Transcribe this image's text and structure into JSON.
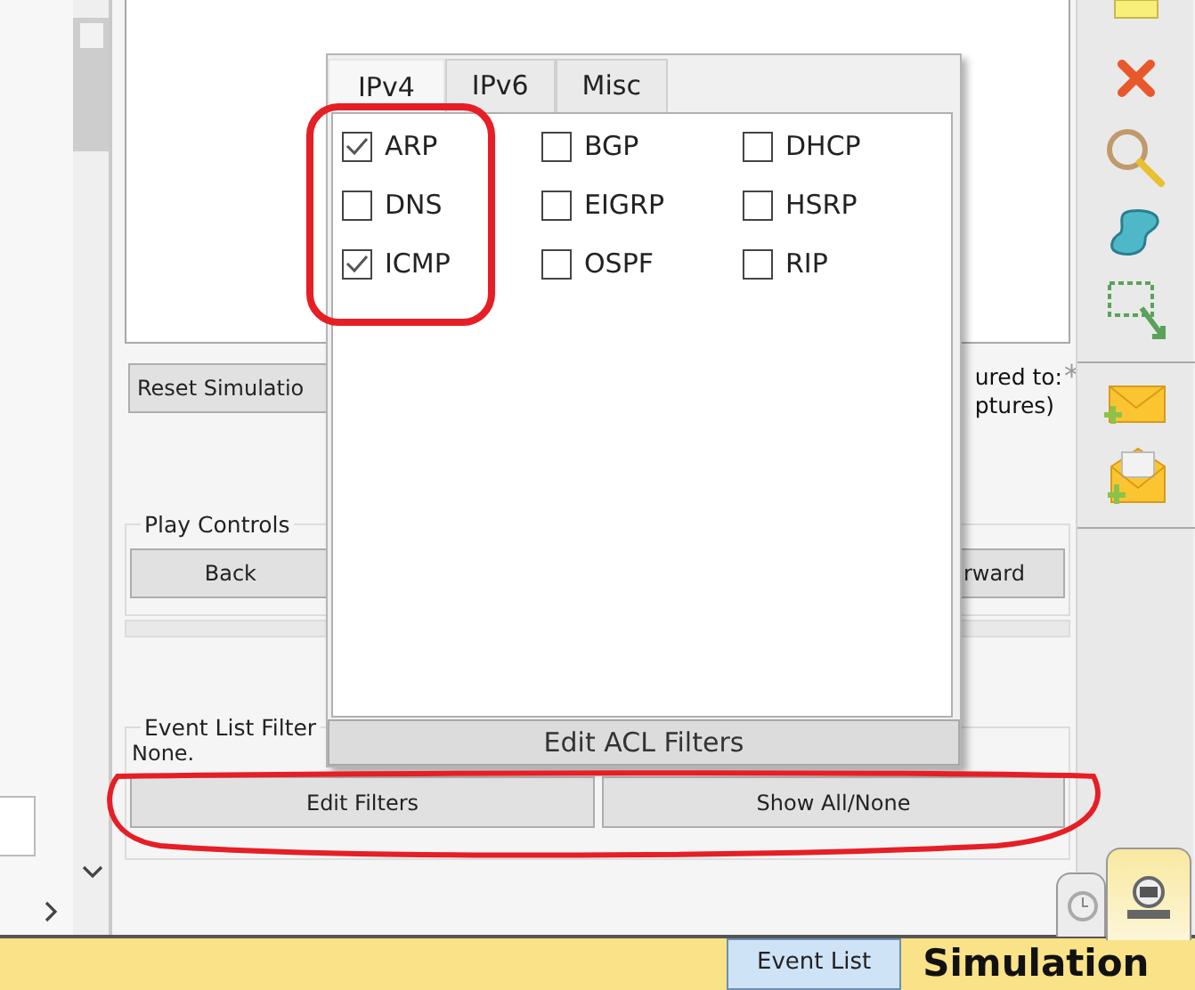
{
  "left_panel": {
    "reset_button": "Reset Simulatio",
    "capture_note": [
      "ured to:",
      "ptures)"
    ],
    "asterisk": "*",
    "play_controls": {
      "legend": "Play Controls",
      "back_button": "Back",
      "forward_button": "rward"
    },
    "event_list_filter": {
      "legend": "Event List Filter",
      "filter_text": "None.",
      "buttons": [
        "Edit Filters",
        "Show All/None"
      ]
    }
  },
  "filter_popup": {
    "tabs": [
      {
        "label": "IPv4",
        "selected": true
      },
      {
        "label": "IPv6",
        "selected": false
      },
      {
        "label": "Misc",
        "selected": false
      }
    ],
    "protocols": [
      {
        "label": "ARP",
        "checked": true
      },
      {
        "label": "BGP",
        "checked": false
      },
      {
        "label": "DHCP",
        "checked": false
      },
      {
        "label": "DNS",
        "checked": false
      },
      {
        "label": "EIGRP",
        "checked": false
      },
      {
        "label": "HSRP",
        "checked": false
      },
      {
        "label": "ICMP",
        "checked": true
      },
      {
        "label": "OSPF",
        "checked": false
      },
      {
        "label": "RIP",
        "checked": false
      }
    ],
    "edit_acl_button": "Edit ACL Filters"
  },
  "mode_tabs": [
    {
      "kind": "realtime",
      "selected": false
    },
    {
      "kind": "simulation",
      "selected": true
    }
  ],
  "status_bar": {
    "tabs": [
      {
        "label": "Event List",
        "selected": true
      }
    ],
    "mode": "Simulation"
  }
}
